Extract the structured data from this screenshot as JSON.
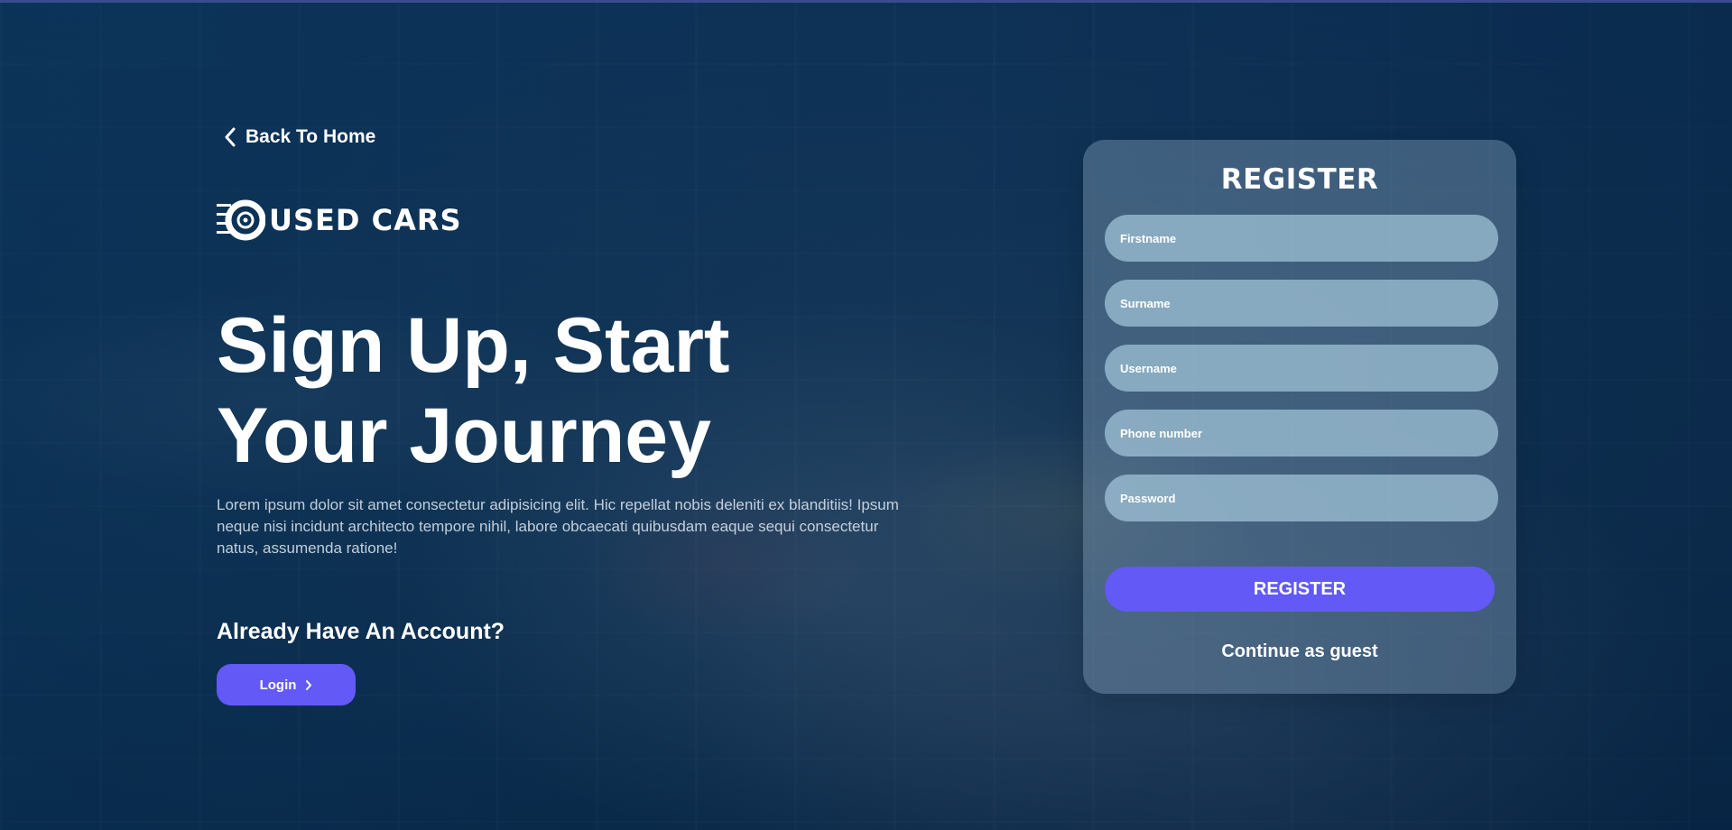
{
  "nav": {
    "back_label": "Back To Home"
  },
  "brand": {
    "logo_text": "USED CARS",
    "logo_icon": "tire-icon"
  },
  "hero": {
    "headline_line1": "Sign Up, Start",
    "headline_line2": "Your Journey",
    "description": "Lorem ipsum dolor sit amet consectetur adipisicing elit. Hic repellat nobis deleniti ex blanditiis! Ipsum neque nisi incidunt architecto tempore nihil, labore obcaecati quibusdam eaque sequi consectetur natus, assumenda ratione!",
    "account_question": "Already Have An Account?",
    "login_label": "Login"
  },
  "register_form": {
    "title": "REGISTER",
    "fields": [
      {
        "placeholder": "Firstname",
        "value": ""
      },
      {
        "placeholder": "Surname",
        "value": ""
      },
      {
        "placeholder": "Username",
        "value": ""
      },
      {
        "placeholder": "Phone number",
        "value": ""
      },
      {
        "placeholder": "Password",
        "value": ""
      }
    ],
    "submit_label": "REGISTER",
    "guest_label": "Continue as guest"
  },
  "colors": {
    "accent": "#6259f7",
    "background": "#0f2a46",
    "card": "#82a0b9",
    "field": "#a0c3d7",
    "text": "#ffffff"
  }
}
